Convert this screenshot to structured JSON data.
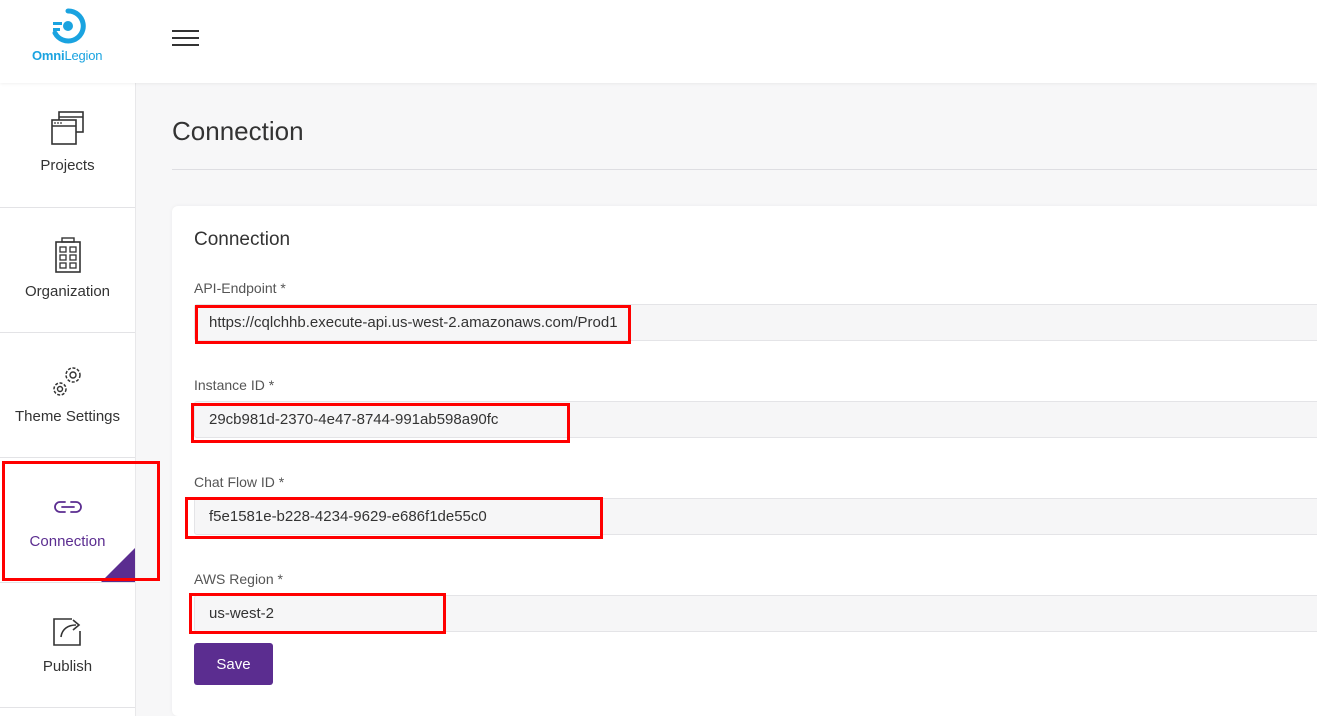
{
  "brand": {
    "name_bold": "Omni",
    "name_light": "Legion",
    "color": "#1aa3e0"
  },
  "header": {
    "menu_icon": "hamburger-icon"
  },
  "sidebar": {
    "items": [
      {
        "label": "Projects",
        "icon": "browser-windows-icon"
      },
      {
        "label": "Organization",
        "icon": "building-icon"
      },
      {
        "label": "Theme Settings",
        "icon": "gears-icon"
      },
      {
        "label": "Connection",
        "icon": "link-icon",
        "active": true
      },
      {
        "label": "Publish",
        "icon": "share-icon"
      }
    ],
    "active_color": "#5b2d90"
  },
  "page": {
    "title": "Connection"
  },
  "form": {
    "title": "Connection",
    "fields": [
      {
        "label": "API-Endpoint *",
        "value": "https://cqlchhb.execute-api.us-west-2.amazonaws.com/Prod1"
      },
      {
        "label": "Instance ID *",
        "value": "29cb981d-2370-4e47-8744-991ab598a90fc"
      },
      {
        "label": "Chat Flow ID *",
        "value": "f5e1581e-b228-4234-9629-e686f1de55c0"
      },
      {
        "label": "AWS Region *",
        "value": "us-west-2"
      }
    ],
    "save_label": "Save",
    "button_color": "#5b2d90"
  },
  "annotations": {
    "highlight_color": "#ff0000"
  }
}
